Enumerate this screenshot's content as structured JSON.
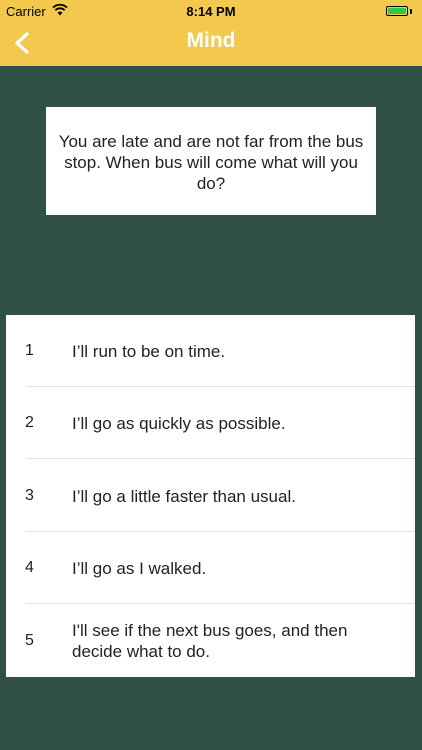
{
  "status_bar": {
    "carrier": "Carrier",
    "time": "8:14 PM",
    "wifi_icon": "wifi-icon",
    "battery_icon": "battery-icon"
  },
  "nav": {
    "title": "Mind",
    "back_icon": "chevron-left-icon"
  },
  "colors": {
    "header": "#f2c94c",
    "background": "#2f4f47",
    "card": "#ffffff"
  },
  "question": {
    "text": "You are late and are not far from the bus stop. When bus will come what will you do?"
  },
  "answers": [
    {
      "number": "1",
      "text": "I’ll run to be on time."
    },
    {
      "number": "2",
      "text": "I’ll go as quickly as possible."
    },
    {
      "number": "3",
      "text": "I’ll go a little faster than usual."
    },
    {
      "number": "4",
      "text": "I’ll go as I walked."
    },
    {
      "number": "5",
      "text": "I'll see if the next bus goes, and then decide what to do."
    }
  ]
}
